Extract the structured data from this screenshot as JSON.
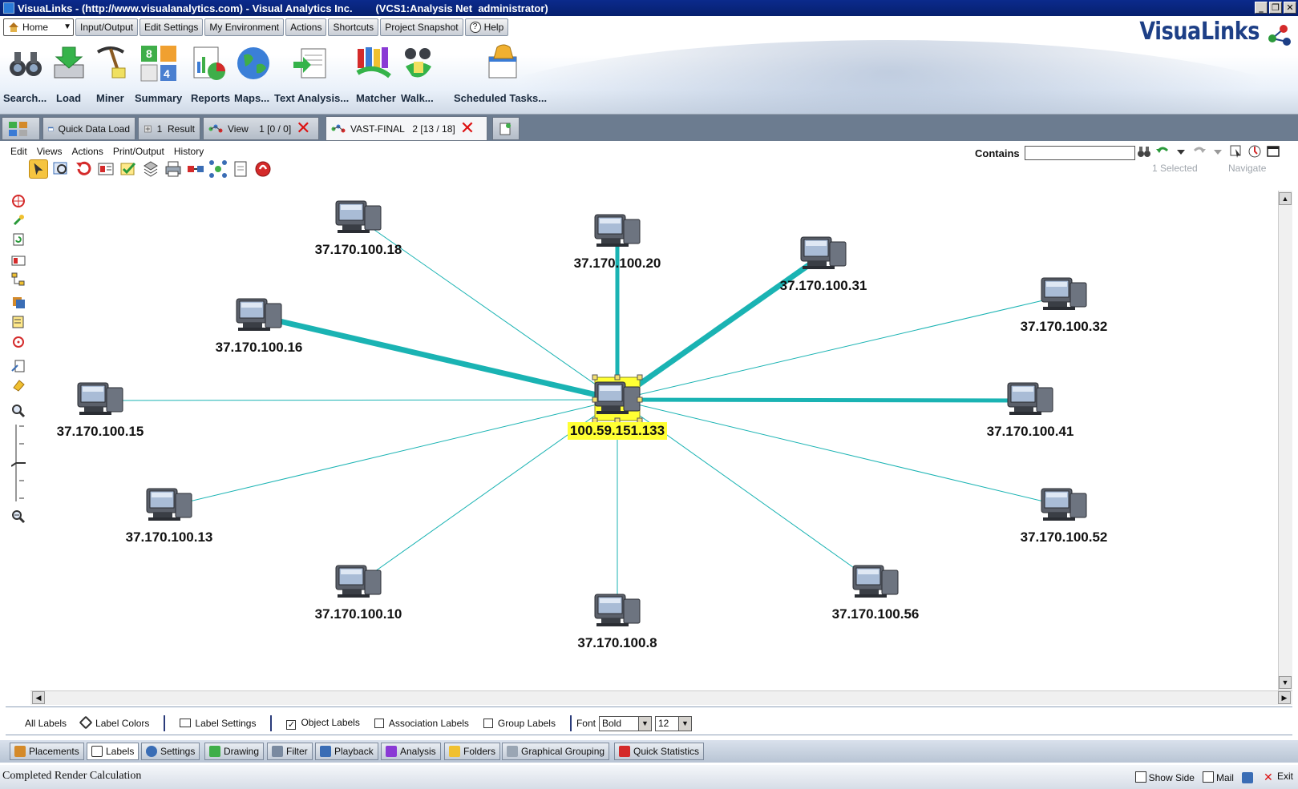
{
  "window": {
    "title": "VisuaLinks - (http://www.visualanalytics.com) - Visual Analytics Inc.        (VCS1:Analysis Net  administrator)",
    "controls": [
      "_",
      "❐",
      "✕"
    ]
  },
  "brand": "VisuaLinks",
  "menu_tabs": [
    "Home",
    "Input/Output",
    "Edit Settings",
    "My Environment",
    "Actions",
    "Shortcuts",
    "Project Snapshot",
    "Help"
  ],
  "big_tools": [
    "Search...",
    "Load",
    "Miner",
    "Summary",
    "Reports",
    "Maps...",
    "Text Analysis...",
    "Matcher",
    "Walk...",
    "Scheduled Tasks..."
  ],
  "doc_tabs": {
    "quick_load": "Quick Data Load",
    "result": "1  Result",
    "view": "View    1 [0 / 0]",
    "vast": "VAST-FINAL   2 [13 / 18]"
  },
  "submenu": [
    "Edit",
    "Views",
    "Actions",
    "Print/Output",
    "History"
  ],
  "search": {
    "label": "Contains",
    "value": "",
    "selected": "1 Selected",
    "navigate": "Navigate"
  },
  "graph": {
    "center": "100.59.151.133",
    "nodes": [
      {
        "label": "37.170.100.18",
        "weight": 1
      },
      {
        "label": "37.170.100.20",
        "weight": 5
      },
      {
        "label": "37.170.100.31",
        "weight": 7
      },
      {
        "label": "37.170.100.32",
        "weight": 1
      },
      {
        "label": "37.170.100.16",
        "weight": 7
      },
      {
        "label": "37.170.100.15",
        "weight": 1
      },
      {
        "label": "37.170.100.41",
        "weight": 5
      },
      {
        "label": "37.170.100.13",
        "weight": 1
      },
      {
        "label": "37.170.100.52",
        "weight": 1
      },
      {
        "label": "37.170.100.10",
        "weight": 1
      },
      {
        "label": "37.170.100.8",
        "weight": 1
      },
      {
        "label": "37.170.100.56",
        "weight": 1
      }
    ],
    "edge_color": "#1ab3b3",
    "highlight_color": "#ffff33"
  },
  "label_bar": {
    "all_labels": "All Labels",
    "label_colors": "Label Colors",
    "label_settings": "Label Settings",
    "object_labels": "Object Labels",
    "object_labels_checked": "✓",
    "association_labels": "Association Labels",
    "group_labels": "Group Labels",
    "font_label": "Font",
    "font_style": "Bold",
    "font_size": "12"
  },
  "bottom_tabs": [
    "Placements",
    "Labels",
    "Settings",
    "Drawing",
    "Filter",
    "Playback",
    "Analysis",
    "Folders",
    "Graphical Grouping",
    "Quick Statistics"
  ],
  "status": {
    "text": "Completed Render Calculation",
    "show_side": "Show Side",
    "mail": "Mail",
    "exit": "Exit"
  }
}
